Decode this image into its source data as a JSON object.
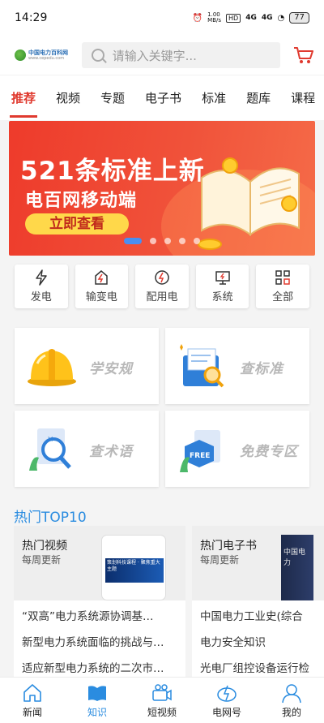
{
  "status": {
    "time": "14:29",
    "speed": "1.00\nMB/s",
    "hd": "HD",
    "net1": "4G",
    "net2": "4G",
    "battery": "77"
  },
  "header": {
    "logo_text": "中国电力百科网",
    "logo_sub": "www.cepedu.com",
    "search_placeholder": "请输入关键字...",
    "cart_icon": "cart-icon"
  },
  "tabs": [
    {
      "label": "推荐",
      "active": true
    },
    {
      "label": "视频"
    },
    {
      "label": "专题"
    },
    {
      "label": "电子书"
    },
    {
      "label": "标准"
    },
    {
      "label": "题库"
    },
    {
      "label": "课程"
    }
  ],
  "banner": {
    "title": "521条标准上新",
    "subtitle": "电百网移动端",
    "button": "立即查看",
    "accent": "#ee3b2b",
    "slide_active": 0,
    "slide_count": 5
  },
  "categories": [
    {
      "label": "发电",
      "icon": "lightning-icon"
    },
    {
      "label": "输变电",
      "icon": "transmission-icon"
    },
    {
      "label": "配用电",
      "icon": "power-icon"
    },
    {
      "label": "系统",
      "icon": "monitor-icon"
    },
    {
      "label": "全部",
      "icon": "grid-icon"
    }
  ],
  "features": [
    {
      "label": "学安规",
      "icon": "helmet-icon"
    },
    {
      "label": "查标准",
      "icon": "document-search-icon"
    },
    {
      "label": "查术语",
      "icon": "term-search-icon"
    },
    {
      "label": "免费专区",
      "icon": "free-icon"
    }
  ],
  "hot": {
    "title": "热门TOP10",
    "cards": [
      {
        "title": "热门视频",
        "subtitle": "每周更新",
        "thumb_text": "策划科技课程 · 聚焦重大主题",
        "items": [
          "“双高”电力系统源协调基…",
          "新型电力系统面临的挑战与…",
          "适应新型电力系统的二次市…"
        ]
      },
      {
        "title": "热门电子书",
        "subtitle": "每周更新",
        "thumb_text": "中国电力",
        "items": [
          "中国电力工业史(综合",
          "电力安全知识",
          "光电厂组控设备运行检"
        ]
      }
    ]
  },
  "bottomnav": [
    {
      "label": "新闻",
      "icon": "home-icon"
    },
    {
      "label": "知识",
      "icon": "book-icon",
      "active": true
    },
    {
      "label": "短视频",
      "icon": "video-icon"
    },
    {
      "label": "电网号",
      "icon": "grid-network-icon"
    },
    {
      "label": "我的",
      "icon": "user-icon"
    }
  ]
}
